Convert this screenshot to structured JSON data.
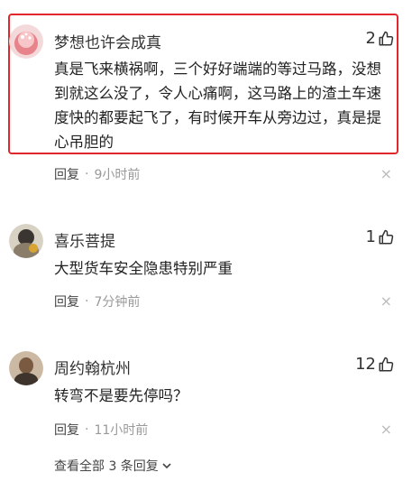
{
  "comments": [
    {
      "username": "梦想也许会成真",
      "likes": "2",
      "text": "真是飞来横祸啊，三个好好端端的等过马路，没想到就这么没了，令人心痛啊，这马路上的渣土车速度快的都要起飞了，有时候开车从旁边过，真是提心吊胆的",
      "reply_label": "回复",
      "separator": "·",
      "time": "9小时前"
    },
    {
      "username": "喜乐菩提",
      "likes": "1",
      "text": "大型货车安全隐患特别严重",
      "reply_label": "回复",
      "separator": "·",
      "time": "7分钟前"
    },
    {
      "username": "周约翰杭州",
      "likes": "12",
      "text": "转弯不是要先停吗？",
      "reply_label": "回复",
      "separator": "·",
      "time": "11小时前"
    }
  ],
  "close_glyph": "×",
  "view_all": "查看全部 3 条回复",
  "colors": {
    "highlight_border": "#e0282c",
    "muted": "#999999"
  }
}
